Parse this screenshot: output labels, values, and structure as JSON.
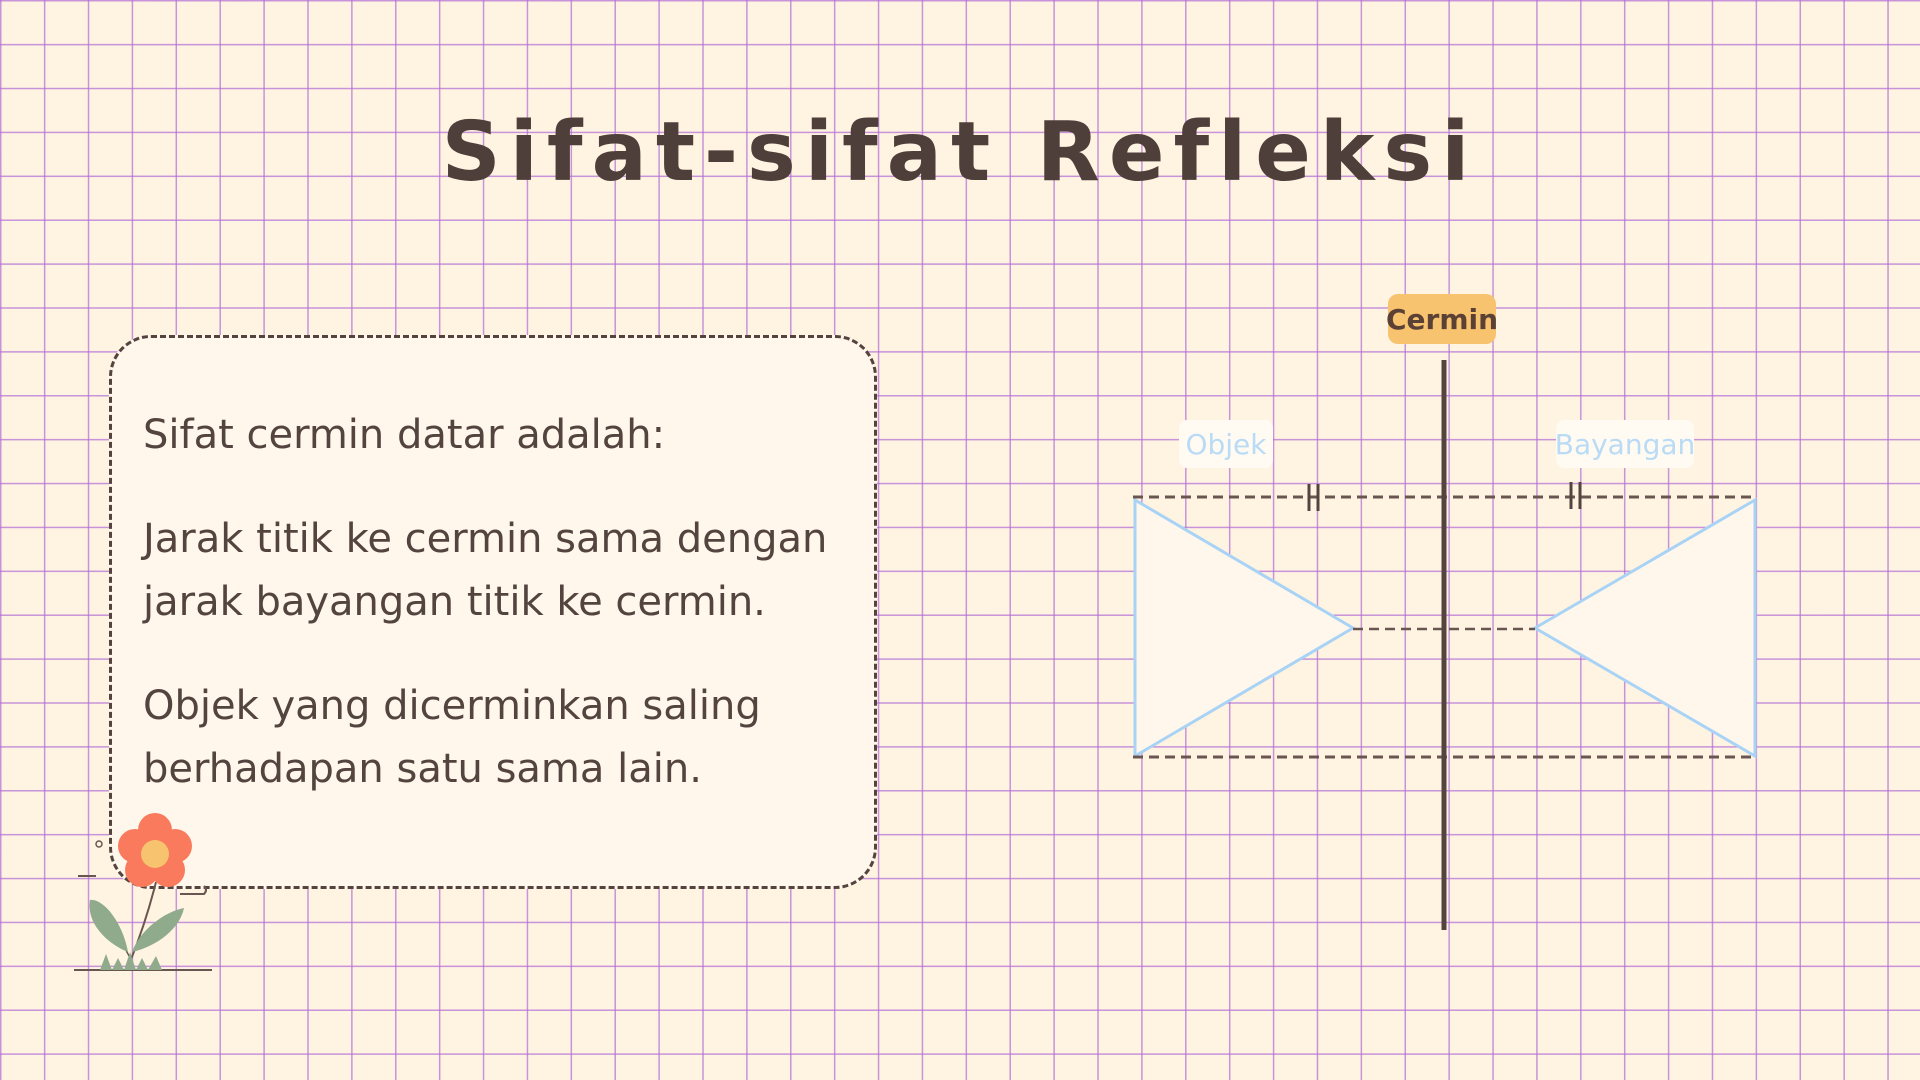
{
  "title": "Sifat-sifat Refleksi",
  "card": {
    "heading": "Sifat cermin datar adalah:",
    "point_1_line_1": "Jarak titik ke cermin sama dengan",
    "point_1_line_2": "jarak bayangan titik ke cermin.",
    "point_2_line_1": "Objek yang dicerminkan saling",
    "point_2_line_2": "berhadapan satu sama lain."
  },
  "diagram": {
    "mirror_label": "Cermin",
    "object_label": "Objek",
    "image_label": "Bayangan",
    "equal_mark": "ǁ"
  },
  "colors": {
    "background": "#fff3e2",
    "grid": "#b26ed6",
    "text": "#53443f",
    "mirror_badge": "#f8c36f",
    "triangle_stroke": "#a9d3f5",
    "label_text": "#b9dbf5",
    "flower_petal": "#f97a5c",
    "flower_center": "#f8c36f",
    "leaf": "#8fab8c"
  },
  "icons": {
    "flower": "flower-illustration"
  }
}
